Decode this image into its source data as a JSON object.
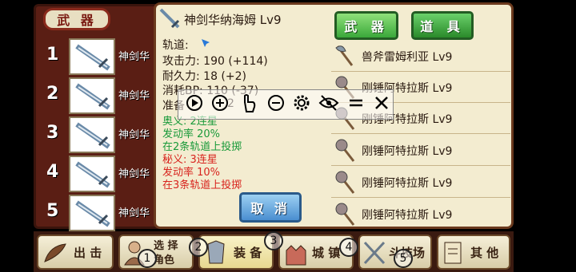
{
  "left_tab": "武 器",
  "slots": [
    {
      "num": "1",
      "name": "神剑华"
    },
    {
      "num": "2",
      "name": "神剑华"
    },
    {
      "num": "3",
      "name": "神剑华"
    },
    {
      "num": "4",
      "name": "神剑华"
    },
    {
      "num": "5",
      "name": "神剑华"
    }
  ],
  "detail": {
    "title": "神剑华纳海姆 Lv9",
    "track_label": "轨道:",
    "attack": "攻击力: 190 (+114)",
    "durability": "耐久力: 18 (+2)",
    "bp_cost": "消耗BP: 110 (-37)",
    "prep": "准备",
    "prep_tail": "2",
    "skill1_name": "奥义: 2连星",
    "skill1_rate": "发动率 20%",
    "skill1_desc": "在2条轨道上投掷",
    "skill2_name": "秘义: 3连星",
    "skill2_rate": "发动率 10%",
    "skill2_desc": "在3条轨道上投掷",
    "cancel": "取 消"
  },
  "tabs": {
    "weapon": "武 器",
    "items": "道 具"
  },
  "items": [
    {
      "name": "兽斧雷姆利亚 Lv9",
      "icon": "axe-icon"
    },
    {
      "name": "刚锤阿特拉斯 Lv9",
      "icon": "mace-icon"
    },
    {
      "name": "刚锤阿特拉斯 Lv9",
      "icon": "mace-icon"
    },
    {
      "name": "刚锤阿特拉斯 Lv9",
      "icon": "mace-icon"
    },
    {
      "name": "刚锤阿特拉斯 Lv9",
      "icon": "mace-icon"
    },
    {
      "name": "刚锤阿特拉斯 Lv9",
      "icon": "mace-icon"
    }
  ],
  "overlay_icons": [
    "play-icon",
    "plus-icon",
    "touch-icon",
    "minus-icon",
    "gear-icon",
    "eye-off-icon",
    "equals-icon",
    "close-icon"
  ],
  "bottom_nav": {
    "sortie": "出 击",
    "select_char_1": "选 择",
    "select_char_2": "角色",
    "equip": "装 备",
    "castle": "城 镇",
    "arena": "斗技场",
    "other": "其 他"
  },
  "markers": [
    "1",
    "2",
    "3",
    "4",
    "5"
  ]
}
